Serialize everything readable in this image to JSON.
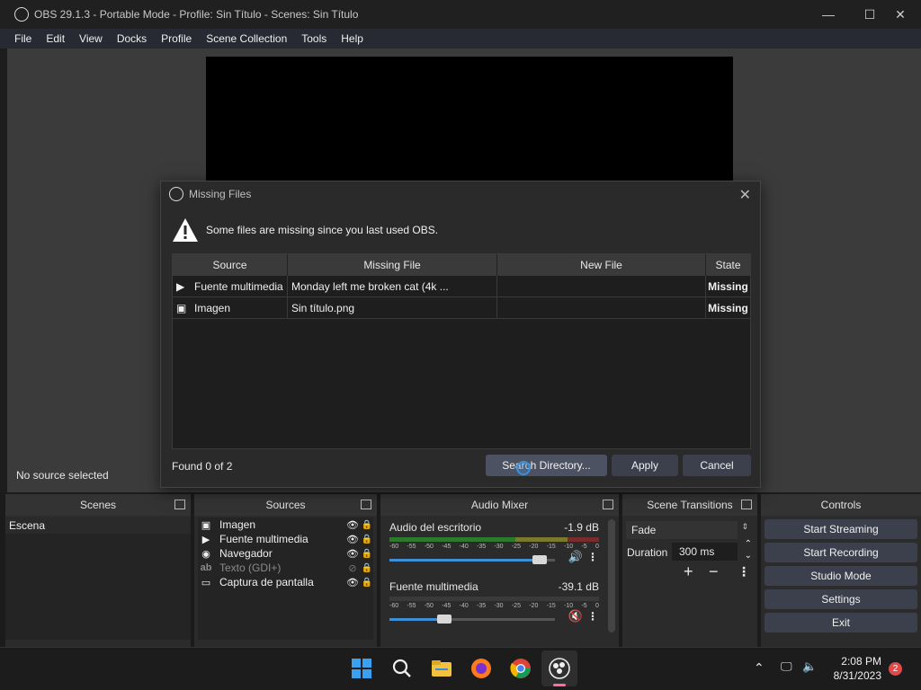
{
  "window": {
    "title": "OBS 29.1.3 - Portable Mode - Profile: Sin Título - Scenes: Sin Título",
    "minimize": "—",
    "maximize": "☐",
    "close": "✕"
  },
  "menu": [
    "File",
    "Edit",
    "View",
    "Docks",
    "Profile",
    "Scene Collection",
    "Tools",
    "Help"
  ],
  "status": {
    "no_source": "No source selected"
  },
  "dialog": {
    "title": "Missing Files",
    "warning": "Some files are missing since you last used OBS.",
    "columns": [
      "Source",
      "Missing File",
      "New File",
      "State"
    ],
    "rows": [
      {
        "icon": "play-icon",
        "source": "Fuente multimedia",
        "missing_file": "Monday left me broken cat (4k ...",
        "new_file": "",
        "state": "Missing"
      },
      {
        "icon": "image-icon",
        "source": "Imagen",
        "missing_file": "Sin título.png",
        "new_file": "",
        "state": "Missing"
      }
    ],
    "found": "Found 0 of 2",
    "search_btn": "Search Directory...",
    "apply_btn": "Apply",
    "cancel_btn": "Cancel"
  },
  "docks": {
    "scenes": {
      "title": "Scenes",
      "items": [
        "Escena"
      ]
    },
    "sources": {
      "title": "Sources",
      "items": [
        {
          "icon": "image-icon",
          "name": "Imagen",
          "hidden": false
        },
        {
          "icon": "play-icon",
          "name": "Fuente multimedia",
          "hidden": false
        },
        {
          "icon": "globe-icon",
          "name": "Navegador",
          "hidden": false
        },
        {
          "icon": "text-icon",
          "name": "Texto (GDI+)",
          "hidden": true
        },
        {
          "icon": "monitor-icon",
          "name": "Captura de pantalla",
          "hidden": false
        }
      ]
    },
    "mixer": {
      "title": "Audio Mixer",
      "tracks": [
        {
          "name": "Audio del escritorio",
          "db": "-1.9 dB",
          "level": 0.91,
          "muted": false
        },
        {
          "name": "Fuente multimedia",
          "db": "-39.1 dB",
          "level": 0.33,
          "muted": true
        }
      ],
      "ticks": [
        "-60",
        "-55",
        "-50",
        "-45",
        "-40",
        "-35",
        "-30",
        "-25",
        "-20",
        "-15",
        "-10",
        "-5",
        "0"
      ]
    },
    "transitions": {
      "title": "Scene Transitions",
      "transition": "Fade",
      "duration_label": "Duration",
      "duration": "300 ms"
    },
    "controls": {
      "title": "Controls",
      "buttons": [
        "Start Streaming",
        "Start Recording",
        "Studio Mode",
        "Settings",
        "Exit"
      ]
    }
  },
  "taskbar": {
    "time": "2:08 PM",
    "date": "8/31/2023",
    "notifications": "2"
  }
}
